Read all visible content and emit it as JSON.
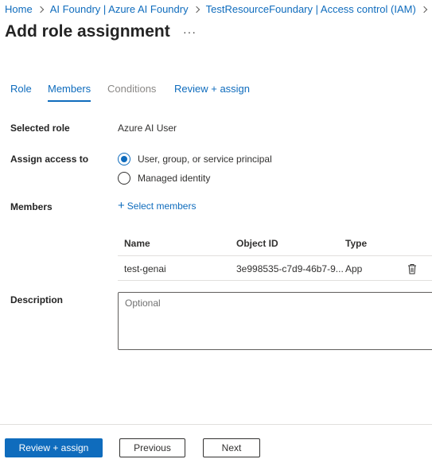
{
  "breadcrumb": [
    "Home",
    "AI Foundry | Azure AI Foundry",
    "TestResourceFoundary | Access control (IAM)"
  ],
  "page": {
    "title": "Add role assignment",
    "more_label": "···"
  },
  "tabs": [
    {
      "label": "Role",
      "state": "normal"
    },
    {
      "label": "Members",
      "state": "active"
    },
    {
      "label": "Conditions",
      "state": "disabled"
    },
    {
      "label": "Review + assign",
      "state": "normal"
    }
  ],
  "form": {
    "selected_role": {
      "label": "Selected role",
      "value": "Azure AI User"
    },
    "assign_access": {
      "label": "Assign access to",
      "options": [
        {
          "label": "User, group, or service principal",
          "checked": true
        },
        {
          "label": "Managed identity",
          "checked": false
        }
      ]
    },
    "members": {
      "label": "Members",
      "select_label": "Select members",
      "table": {
        "columns": [
          "Name",
          "Object ID",
          "Type"
        ],
        "rows": [
          {
            "name": "test-genai",
            "object_id": "3e998535-c7d9-46b7-9...",
            "type": "App"
          }
        ]
      }
    },
    "description": {
      "label": "Description",
      "placeholder": "Optional"
    }
  },
  "footer": {
    "primary_label": "Review + assign",
    "previous_label": "Previous",
    "next_label": "Next"
  },
  "colors": {
    "accent": "#0f6cbd",
    "text": "#323130",
    "disabled": "#8a8886"
  }
}
